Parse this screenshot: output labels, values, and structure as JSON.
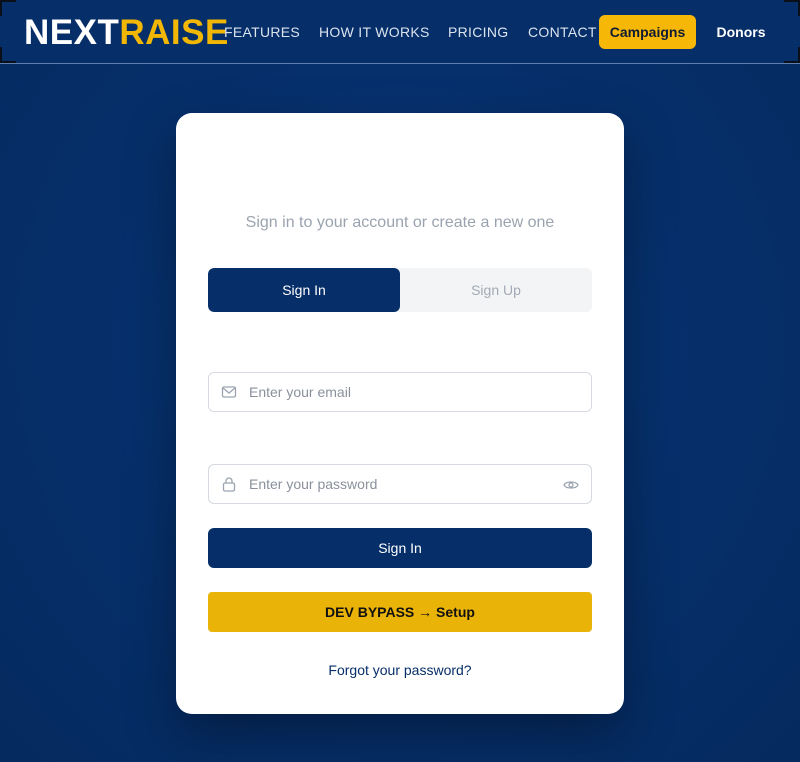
{
  "brand": {
    "part1": "NEXT",
    "part2": "RAISE",
    "color_primary": "#ffffff",
    "color_accent": "#f2b705"
  },
  "nav": {
    "links": [
      "FEATURES",
      "HOW IT WORKS",
      "PRICING",
      "CONTACT"
    ],
    "campaigns_label": "Campaigns",
    "donors_label": "Donors"
  },
  "auth": {
    "subtitle": "Sign in to your account or create a new one",
    "tabs": [
      {
        "label": "Sign In",
        "active": true
      },
      {
        "label": "Sign Up",
        "active": false
      }
    ],
    "email": {
      "placeholder": "Enter your email",
      "value": "",
      "icon": "mail-icon"
    },
    "password": {
      "placeholder": "Enter your password",
      "value": "",
      "icon": "lock-icon",
      "toggle_icon": "eye-icon"
    },
    "submit_label": "Sign In",
    "dev_bypass_label": "DEV BYPASS → Setup",
    "forgot_label": "Forgot your password?"
  },
  "colors": {
    "navy": "#062e69",
    "yellow": "#eab308",
    "campaigns_yellow": "#f6b707"
  }
}
